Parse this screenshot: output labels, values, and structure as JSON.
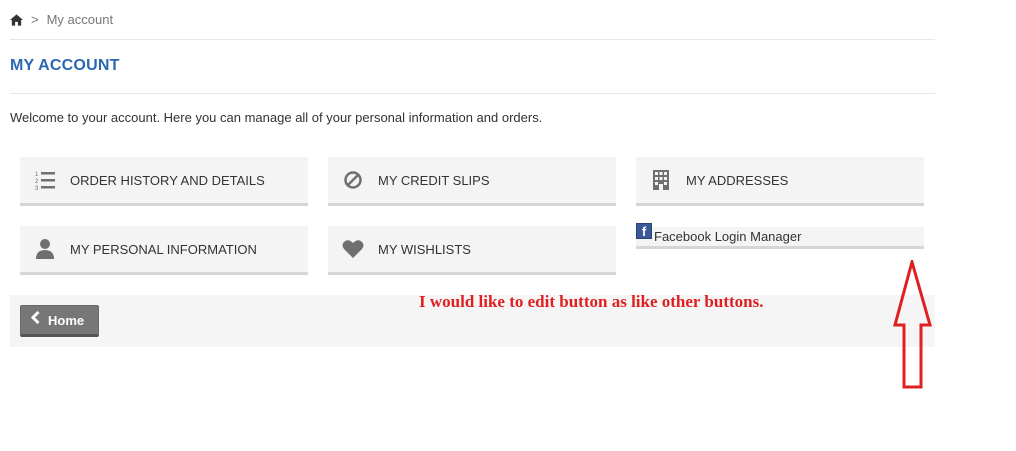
{
  "breadcrumb": {
    "home_icon": "home-icon",
    "separator": ">",
    "current": "My account"
  },
  "page": {
    "title": "MY ACCOUNT",
    "welcome": "Welcome to your account. Here you can manage all of your personal information and orders."
  },
  "tiles": [
    {
      "label": "ORDER HISTORY AND DETAILS",
      "icon": "list-ordered-icon"
    },
    {
      "label": "MY CREDIT SLIPS",
      "icon": "ban-icon"
    },
    {
      "label": "MY ADDRESSES",
      "icon": "building-icon"
    },
    {
      "label": "MY PERSONAL INFORMATION",
      "icon": "user-icon"
    },
    {
      "label": "MY WISHLISTS",
      "icon": "heart-icon"
    }
  ],
  "facebook": {
    "label": "Facebook Login Manager",
    "icon": "facebook-icon",
    "icon_glyph": "f"
  },
  "footer": {
    "home_label": "Home",
    "icon": "chevron-left-icon"
  },
  "annotation": {
    "text": "I would like to edit button as like other buttons.",
    "color": "#e02020",
    "arrow": "up-arrow-icon"
  },
  "colors": {
    "title": "#2a68b2",
    "tile_bg": "#f4f4f4",
    "home_button": "#777777"
  }
}
